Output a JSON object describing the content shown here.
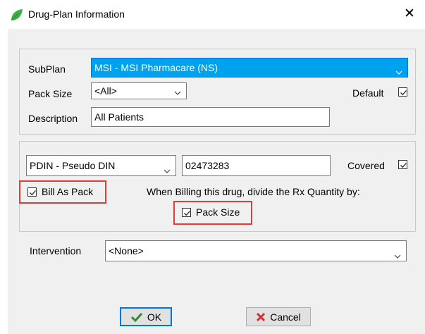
{
  "window": {
    "title": "Drug-Plan Information",
    "close_glyph": "✕",
    "icon": "leaf-icon"
  },
  "plan": {
    "subplan_label": "SubPlan",
    "subplan_value": "MSI - MSI Pharmacare (NS)",
    "packsize_label": "Pack Size",
    "packsize_value": "<All>",
    "default_label": "Default",
    "default_checked": true,
    "description_label": "Description",
    "description_value": "All Patients"
  },
  "drug": {
    "type_value": "PDIN - Pseudo DIN",
    "din_value": "02473283",
    "covered_label": "Covered",
    "covered_checked": true,
    "bill_as_pack_label": "Bill As Pack",
    "bill_as_pack_checked": true,
    "billing_note": "When Billing this drug, divide the Rx Quantity by:",
    "pack_size_label": "Pack Size",
    "pack_size_checked": true
  },
  "intervention": {
    "label": "Intervention",
    "value": "<None>"
  },
  "buttons": {
    "ok_label": "OK",
    "cancel_label": "Cancel"
  },
  "colors": {
    "selection": "#00a2ed",
    "highlight": "#e03c3c",
    "default_border": "#0078d7",
    "ok_check": "#2e8b2e",
    "cancel_x": "#d03030"
  }
}
